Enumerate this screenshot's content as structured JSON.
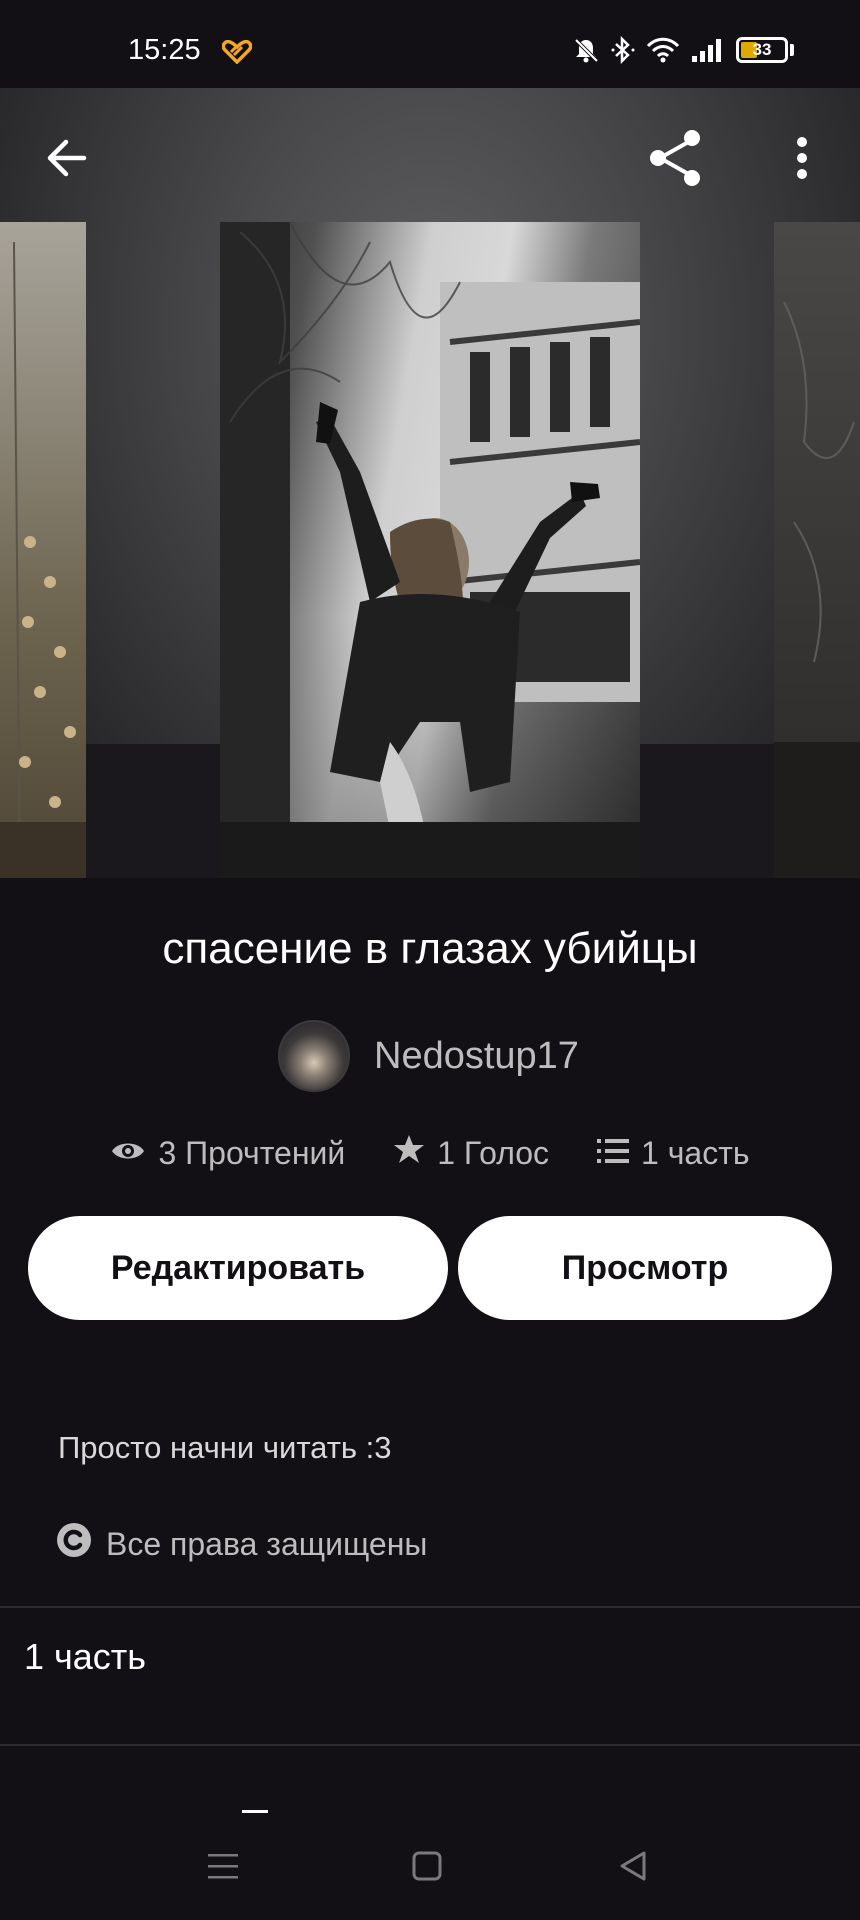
{
  "status_bar": {
    "time": "15:25",
    "battery_level": "33",
    "icons": [
      "heart-icon",
      "bell-muted-icon",
      "bluetooth-icon",
      "wifi-icon",
      "signal-icon",
      "battery-icon"
    ]
  },
  "toolbar": {
    "back_icon": "arrow-left-icon",
    "share_icon": "share-icon",
    "more_icon": "more-vertical-icon"
  },
  "story": {
    "title": "спасение в глазах убийцы",
    "author": "Nedostup17",
    "stats": {
      "reads": "3 Прочтений",
      "votes": "1 Голос",
      "parts": "1 часть"
    },
    "description": "Просто начни читать :3",
    "copyright": "Все права защищены"
  },
  "actions": {
    "edit_label": "Редактировать",
    "view_label": "Просмотр"
  },
  "parts_list": {
    "items": [
      {
        "label": "1 часть"
      }
    ]
  },
  "colors": {
    "background": "#121015",
    "button_bg": "#ffffff",
    "muted_text": "#bdbdbd",
    "accent_heart": "#f5a623"
  }
}
